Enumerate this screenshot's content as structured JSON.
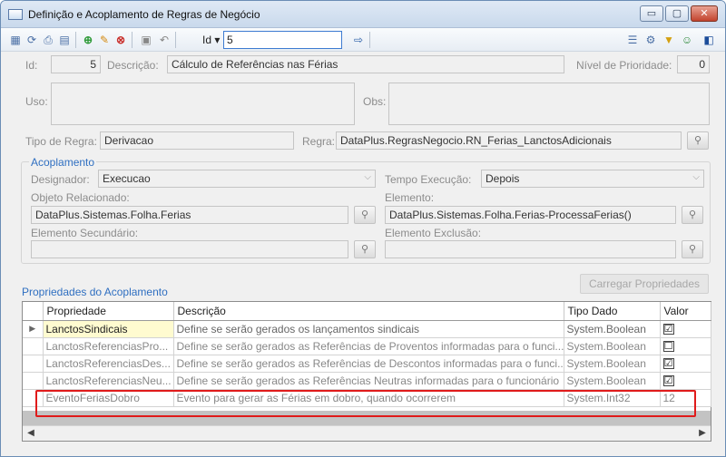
{
  "window": {
    "title": "Definição e Acoplamento de Regras de Negócio",
    "buttons": {
      "minimize": "▭",
      "maximize": "▢",
      "close": "✕"
    }
  },
  "toolbar": {
    "id_label": "Id ▾",
    "id_value": "5",
    "icons": [
      "grid-icon",
      "refresh-icon",
      "print-icon",
      "table-icon",
      "add-icon",
      "edit-icon",
      "delete-icon",
      "save-icon",
      "undo-icon"
    ],
    "right_icons": [
      "list-icon",
      "settings-icon",
      "filter-icon",
      "user-icon",
      "exit-icon"
    ]
  },
  "form": {
    "id_label": "Id:",
    "id_value": "5",
    "descricao_label": "Descrição:",
    "descricao_value": "Cálculo de Referências nas Férias",
    "prioridade_label": "Nível de Prioridade:",
    "prioridade_value": "0",
    "uso_label": "Uso:",
    "uso_value": "",
    "obs_label": "Obs:",
    "obs_value": "",
    "tipo_regra_label": "Tipo de Regra:",
    "tipo_regra_value": "Derivacao",
    "regra_label": "Regra:",
    "regra_value": "DataPlus.RegrasNegocio.RN_Ferias_LanctosAdicionais"
  },
  "acoplamento": {
    "title": "Acoplamento",
    "designador_label": "Designador:",
    "designador_value": "Execucao",
    "tempo_label": "Tempo Execução:",
    "tempo_value": "Depois",
    "objeto_label": "Objeto Relacionado:",
    "objeto_value": "DataPlus.Sistemas.Folha.Ferias",
    "elemento_label": "Elemento:",
    "elemento_value": "DataPlus.Sistemas.Folha.Ferias-ProcessaFerias()",
    "elemento_sec_label": "Elemento Secundário:",
    "elemento_sec_value": "",
    "elemento_exc_label": "Elemento Exclusão:",
    "elemento_exc_value": ""
  },
  "propriedades": {
    "title": "Propriedades do Acoplamento",
    "load_button": "Carregar Propriedades",
    "columns": [
      "Propriedade",
      "Descrição",
      "Tipo Dado",
      "Valor"
    ],
    "rows": [
      {
        "prop": "LanctosSindicais",
        "desc": "Define se serão gerados os lançamentos sindicais",
        "tipo": "System.Boolean",
        "valor": "☑",
        "current": true
      },
      {
        "prop": "LanctosReferenciasPro...",
        "desc": "Define se serão gerados as Referências de Proventos informadas para o funci...",
        "tipo": "System.Boolean",
        "valor": "☐"
      },
      {
        "prop": "LanctosReferenciasDes...",
        "desc": "Define se serão gerados as Referências de Descontos informadas para o funci...",
        "tipo": "System.Boolean",
        "valor": "☑"
      },
      {
        "prop": "LanctosReferenciasNeu...",
        "desc": "Define se serão gerados as Referências Neutras informadas para o funcionário",
        "tipo": "System.Boolean",
        "valor": "☑"
      },
      {
        "prop": "EventoFeriasDobro",
        "desc": "Evento para gerar as Férias em dobro, quando ocorrerem",
        "tipo": "System.Int32",
        "valor": "12"
      }
    ]
  },
  "colors": {
    "accent": "#2f6fc1",
    "highlight": "#e01b1b"
  }
}
